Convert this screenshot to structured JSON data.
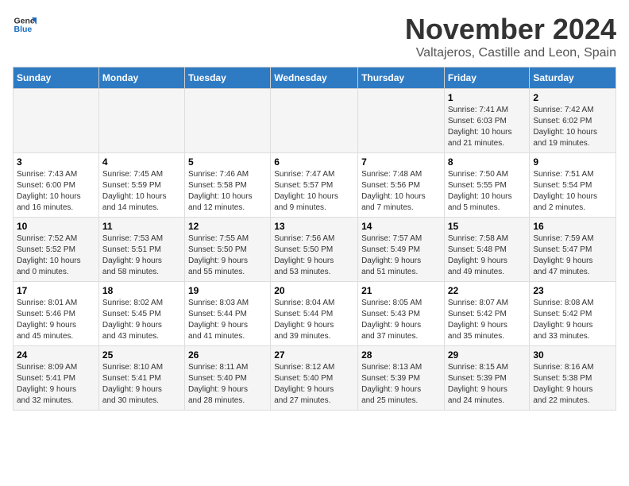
{
  "logo": {
    "text_general": "General",
    "text_blue": "Blue"
  },
  "title": {
    "month": "November 2024",
    "location": "Valtajeros, Castille and Leon, Spain"
  },
  "headers": [
    "Sunday",
    "Monday",
    "Tuesday",
    "Wednesday",
    "Thursday",
    "Friday",
    "Saturday"
  ],
  "weeks": [
    [
      {
        "day": "",
        "info": ""
      },
      {
        "day": "",
        "info": ""
      },
      {
        "day": "",
        "info": ""
      },
      {
        "day": "",
        "info": ""
      },
      {
        "day": "",
        "info": ""
      },
      {
        "day": "1",
        "info": "Sunrise: 7:41 AM\nSunset: 6:03 PM\nDaylight: 10 hours\nand 21 minutes."
      },
      {
        "day": "2",
        "info": "Sunrise: 7:42 AM\nSunset: 6:02 PM\nDaylight: 10 hours\nand 19 minutes."
      }
    ],
    [
      {
        "day": "3",
        "info": "Sunrise: 7:43 AM\nSunset: 6:00 PM\nDaylight: 10 hours\nand 16 minutes."
      },
      {
        "day": "4",
        "info": "Sunrise: 7:45 AM\nSunset: 5:59 PM\nDaylight: 10 hours\nand 14 minutes."
      },
      {
        "day": "5",
        "info": "Sunrise: 7:46 AM\nSunset: 5:58 PM\nDaylight: 10 hours\nand 12 minutes."
      },
      {
        "day": "6",
        "info": "Sunrise: 7:47 AM\nSunset: 5:57 PM\nDaylight: 10 hours\nand 9 minutes."
      },
      {
        "day": "7",
        "info": "Sunrise: 7:48 AM\nSunset: 5:56 PM\nDaylight: 10 hours\nand 7 minutes."
      },
      {
        "day": "8",
        "info": "Sunrise: 7:50 AM\nSunset: 5:55 PM\nDaylight: 10 hours\nand 5 minutes."
      },
      {
        "day": "9",
        "info": "Sunrise: 7:51 AM\nSunset: 5:54 PM\nDaylight: 10 hours\nand 2 minutes."
      }
    ],
    [
      {
        "day": "10",
        "info": "Sunrise: 7:52 AM\nSunset: 5:52 PM\nDaylight: 10 hours\nand 0 minutes."
      },
      {
        "day": "11",
        "info": "Sunrise: 7:53 AM\nSunset: 5:51 PM\nDaylight: 9 hours\nand 58 minutes."
      },
      {
        "day": "12",
        "info": "Sunrise: 7:55 AM\nSunset: 5:50 PM\nDaylight: 9 hours\nand 55 minutes."
      },
      {
        "day": "13",
        "info": "Sunrise: 7:56 AM\nSunset: 5:50 PM\nDaylight: 9 hours\nand 53 minutes."
      },
      {
        "day": "14",
        "info": "Sunrise: 7:57 AM\nSunset: 5:49 PM\nDaylight: 9 hours\nand 51 minutes."
      },
      {
        "day": "15",
        "info": "Sunrise: 7:58 AM\nSunset: 5:48 PM\nDaylight: 9 hours\nand 49 minutes."
      },
      {
        "day": "16",
        "info": "Sunrise: 7:59 AM\nSunset: 5:47 PM\nDaylight: 9 hours\nand 47 minutes."
      }
    ],
    [
      {
        "day": "17",
        "info": "Sunrise: 8:01 AM\nSunset: 5:46 PM\nDaylight: 9 hours\nand 45 minutes."
      },
      {
        "day": "18",
        "info": "Sunrise: 8:02 AM\nSunset: 5:45 PM\nDaylight: 9 hours\nand 43 minutes."
      },
      {
        "day": "19",
        "info": "Sunrise: 8:03 AM\nSunset: 5:44 PM\nDaylight: 9 hours\nand 41 minutes."
      },
      {
        "day": "20",
        "info": "Sunrise: 8:04 AM\nSunset: 5:44 PM\nDaylight: 9 hours\nand 39 minutes."
      },
      {
        "day": "21",
        "info": "Sunrise: 8:05 AM\nSunset: 5:43 PM\nDaylight: 9 hours\nand 37 minutes."
      },
      {
        "day": "22",
        "info": "Sunrise: 8:07 AM\nSunset: 5:42 PM\nDaylight: 9 hours\nand 35 minutes."
      },
      {
        "day": "23",
        "info": "Sunrise: 8:08 AM\nSunset: 5:42 PM\nDaylight: 9 hours\nand 33 minutes."
      }
    ],
    [
      {
        "day": "24",
        "info": "Sunrise: 8:09 AM\nSunset: 5:41 PM\nDaylight: 9 hours\nand 32 minutes."
      },
      {
        "day": "25",
        "info": "Sunrise: 8:10 AM\nSunset: 5:41 PM\nDaylight: 9 hours\nand 30 minutes."
      },
      {
        "day": "26",
        "info": "Sunrise: 8:11 AM\nSunset: 5:40 PM\nDaylight: 9 hours\nand 28 minutes."
      },
      {
        "day": "27",
        "info": "Sunrise: 8:12 AM\nSunset: 5:40 PM\nDaylight: 9 hours\nand 27 minutes."
      },
      {
        "day": "28",
        "info": "Sunrise: 8:13 AM\nSunset: 5:39 PM\nDaylight: 9 hours\nand 25 minutes."
      },
      {
        "day": "29",
        "info": "Sunrise: 8:15 AM\nSunset: 5:39 PM\nDaylight: 9 hours\nand 24 minutes."
      },
      {
        "day": "30",
        "info": "Sunrise: 8:16 AM\nSunset: 5:38 PM\nDaylight: 9 hours\nand 22 minutes."
      }
    ]
  ]
}
